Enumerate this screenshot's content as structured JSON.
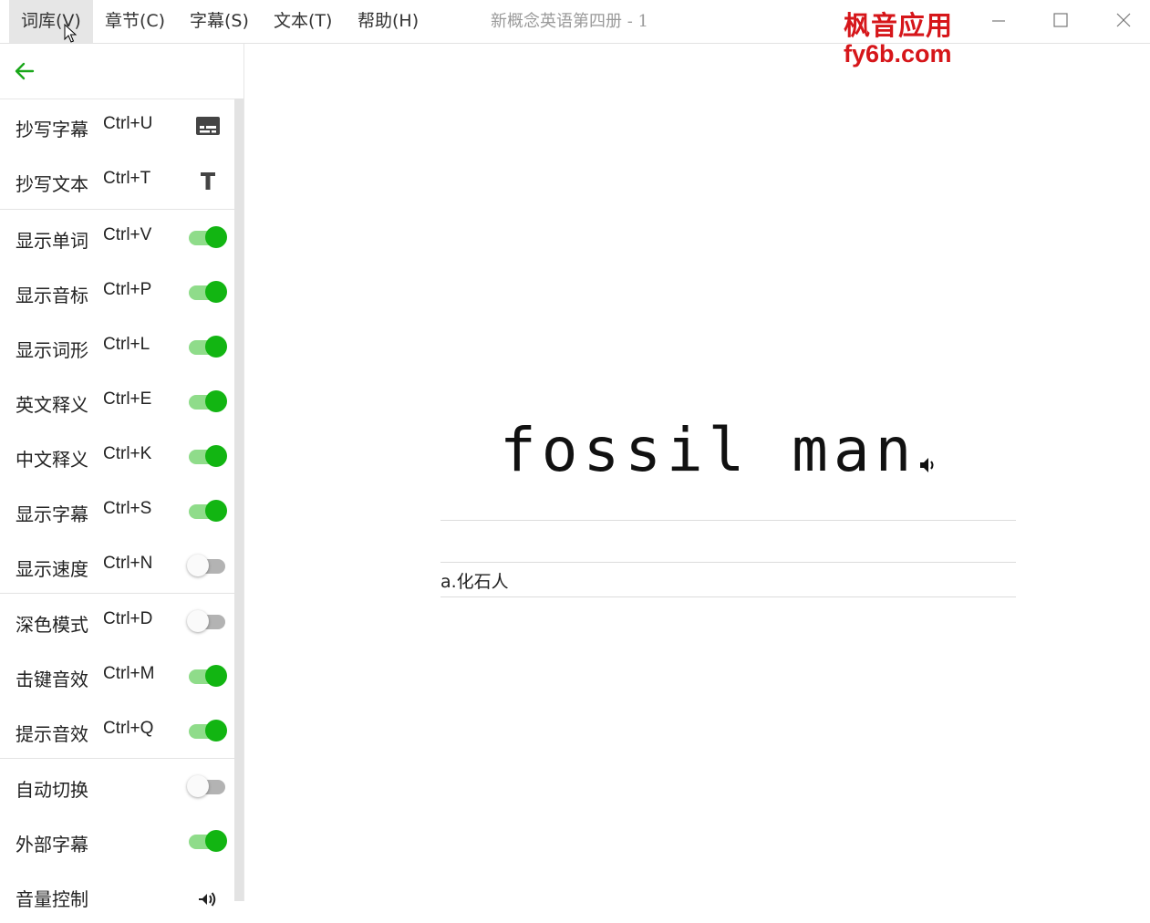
{
  "menu": [
    {
      "label": "词库(V)",
      "active": true
    },
    {
      "label": "章节(C)"
    },
    {
      "label": "字幕(S)"
    },
    {
      "label": "文本(T)"
    },
    {
      "label": "帮助(H)"
    }
  ],
  "window_title": "新概念英语第四册 - 1",
  "brand": {
    "line1": "枫音应用",
    "line2": "fy6b.com",
    "color": "#d6161a"
  },
  "sidebar": {
    "back_icon": "arrow-left-icon",
    "items": [
      {
        "label": "抄写字幕",
        "shortcut": "Ctrl+U",
        "control": "subtitles-icon"
      },
      {
        "label": "抄写文本",
        "shortcut": "Ctrl+T",
        "control": "text-icon"
      },
      {
        "label": "显示单词",
        "shortcut": "Ctrl+V",
        "control": "toggle",
        "on": true
      },
      {
        "label": "显示音标",
        "shortcut": "Ctrl+P",
        "control": "toggle",
        "on": true
      },
      {
        "label": "显示词形",
        "shortcut": "Ctrl+L",
        "control": "toggle",
        "on": true
      },
      {
        "label": "英文释义",
        "shortcut": "Ctrl+E",
        "control": "toggle",
        "on": true
      },
      {
        "label": "中文释义",
        "shortcut": "Ctrl+K",
        "control": "toggle",
        "on": true
      },
      {
        "label": "显示字幕",
        "shortcut": "Ctrl+S",
        "control": "toggle",
        "on": true
      },
      {
        "label": "显示速度",
        "shortcut": "Ctrl+N",
        "control": "toggle",
        "on": false
      },
      {
        "label": "深色模式",
        "shortcut": "Ctrl+D",
        "control": "toggle",
        "on": false
      },
      {
        "label": "击键音效",
        "shortcut": "Ctrl+M",
        "control": "toggle",
        "on": true
      },
      {
        "label": "提示音效",
        "shortcut": "Ctrl+Q",
        "control": "toggle",
        "on": true
      },
      {
        "label": "自动切换",
        "shortcut": "",
        "control": "toggle",
        "on": false
      },
      {
        "label": "外部字幕",
        "shortcut": "",
        "control": "toggle",
        "on": true
      },
      {
        "label": "音量控制",
        "shortcut": "",
        "control": "volume-icon"
      }
    ]
  },
  "main": {
    "word": "fossil man",
    "speaker_icon": "speaker-icon",
    "definition": "a.化石人"
  },
  "colors": {
    "accent_green": "#12b512",
    "track_green": "#8fdc8a"
  }
}
